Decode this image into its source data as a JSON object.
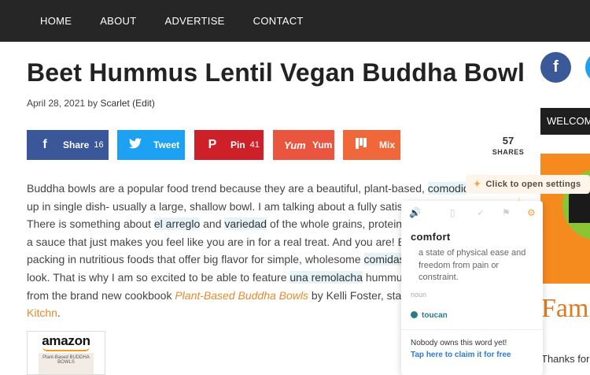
{
  "nav": {
    "items": [
      "HOME",
      "ABOUT",
      "ADVERTISE",
      "CONTACT"
    ]
  },
  "article": {
    "title": "Beet Hummus Lentil Vegan Buddha Bowl",
    "date": "April 28, 2021",
    "by": "by",
    "author": "Scarlet",
    "edit": "(Edit)"
  },
  "share": {
    "facebook": {
      "label": "Share",
      "count": "16",
      "icon": "facebook-icon"
    },
    "twitter": {
      "label": "Tweet",
      "icon": "twitter-icon"
    },
    "pinterest": {
      "label": "Pin",
      "count": "41",
      "icon": "pinterest-icon"
    },
    "yummly": {
      "label": "Yum",
      "icon_text": "Yum",
      "icon": "yummly-icon"
    },
    "mix": {
      "label": "Mix",
      "icon": "mix-icon"
    },
    "total": "57",
    "total_label": "SHARES"
  },
  "body": {
    "l1a": "Buddha bowls are a popular food trend because they are a beautiful, plant-based, ",
    "l1hl": "comodidad",
    "l1b": " fo",
    "l2": "up in single dish- usually a large, shallow bowl. I am talking about a fully satisfying",
    "l3a": "There is something about ",
    "l3hl1": "el arreglo",
    "l3b": " and ",
    "l3hl2": "variedad",
    "l3c": " of the whole grains, proteins, and",
    "l4": "a sauce that just makes you feel like you are in for a real treat. And you are! Buddh",
    "l5a": "packing in nutritious foods that offer big flavor for simple, wholesome ",
    "l5hl": "comidas",
    "l5b": " th",
    "l6a": "look. That is why I am so excited to be able to feature ",
    "l6hl": "una remolacha",
    "l6b": " hummus len",
    "l7a": "from the brand new cookbook ",
    "l7link": "Plant-Based Buddha Bowls",
    "l7b": " by Kelli Foster, staff wr",
    "l8link": "Kitchn",
    "l8b": "."
  },
  "amazon": {
    "logo": "amazon",
    "book_title": "Plant-Based BUDDHA BOWLS"
  },
  "sidebar": {
    "facebook_icon": "facebook-icon",
    "welcome": "WELCOME",
    "fam_text": "Fam",
    "thanks": "Thanks for"
  },
  "popup": {
    "tip": "Click to open settings",
    "word": "comfort",
    "definition": "a state of physical ease and freedom from pain or constraint.",
    "pos": "noun",
    "brand": "toucan",
    "owns": "Nobody owns this word yet!",
    "claim": "Tap here to claim it for free"
  },
  "colors": {
    "nav_bg": "#262626",
    "facebook": "#3a579a",
    "twitter": "#1da1f2",
    "pinterest": "#cd2029",
    "yummly": "#e9553f",
    "mix": "#f0673a",
    "link_orange": "#e58a2c",
    "highlight": "#e6f3f8",
    "toucan_teal": "#2b7a8c",
    "claim_blue": "#2f7bd3"
  }
}
